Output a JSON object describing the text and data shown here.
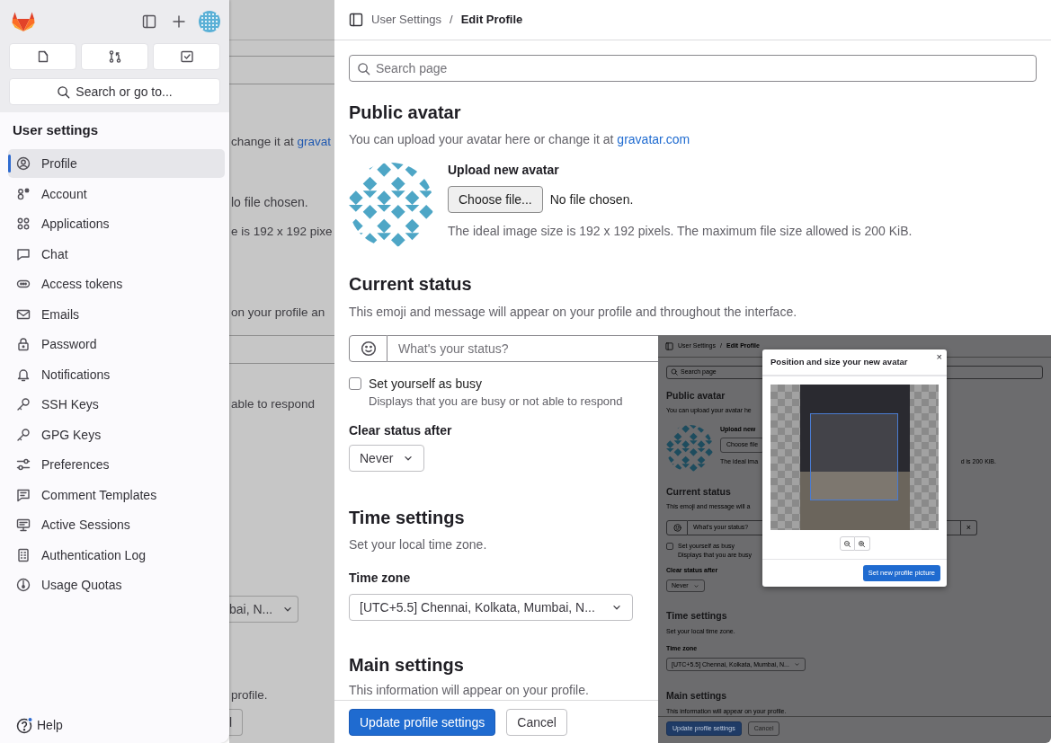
{
  "sidebar": {
    "search_button": "Search or go to...",
    "heading": "User settings",
    "items": [
      {
        "label": "Profile",
        "selected": true
      },
      {
        "label": "Account",
        "selected": false
      },
      {
        "label": "Applications",
        "selected": false
      },
      {
        "label": "Chat",
        "selected": false
      },
      {
        "label": "Access tokens",
        "selected": false
      },
      {
        "label": "Emails",
        "selected": false
      },
      {
        "label": "Password",
        "selected": false
      },
      {
        "label": "Notifications",
        "selected": false
      },
      {
        "label": "SSH Keys",
        "selected": false
      },
      {
        "label": "GPG Keys",
        "selected": false
      },
      {
        "label": "Preferences",
        "selected": false
      },
      {
        "label": "Comment Templates",
        "selected": false
      },
      {
        "label": "Active Sessions",
        "selected": false
      },
      {
        "label": "Authentication Log",
        "selected": false
      },
      {
        "label": "Usage Quotas",
        "selected": false
      }
    ],
    "help": "Help"
  },
  "background_page": {
    "description": "change it at ",
    "link": "gravat",
    "no_file": "lo file chosen.",
    "hint": "e is 192 x 192 pixe",
    "status_description": "on your profile an",
    "busy_help": "able to respond",
    "time_zone": "bai, N...",
    "main_description": "profile.",
    "cancel_button": "l"
  },
  "breadcrumb": {
    "items": [
      "User Settings",
      "Edit Profile"
    ],
    "separator": "/"
  },
  "search": {
    "placeholder": "Search page"
  },
  "public_avatar": {
    "title": "Public avatar",
    "description": "You can upload your avatar here or change it at ",
    "link": "gravatar.com",
    "upload_label": "Upload new avatar",
    "choose_button": "Choose file...",
    "no_file": "No file chosen.",
    "hint": "The ideal image size is 192 x 192 pixels. The maximum file size allowed is 200 KiB."
  },
  "current_status": {
    "title": "Current status",
    "description": "This emoji and message will appear on your profile and throughout the interface.",
    "status_placeholder": "What's your status?",
    "busy": {
      "label": "Set yourself as busy",
      "help": "Displays that you are busy or not able to respond",
      "checked": false
    },
    "clear_label": "Clear status after",
    "clear_value": "Never"
  },
  "time_settings": {
    "title": "Time settings",
    "description": "Set your local time zone.",
    "zone_label": "Time zone",
    "zone_value": "[UTC+5.5] Chennai, Kolkata, Mumbai, N..."
  },
  "main_settings": {
    "title": "Main settings",
    "description": "This information will appear on your profile."
  },
  "footer": {
    "buttons": [
      {
        "label": "Update profile settings",
        "kind": "primary"
      },
      {
        "label": "Cancel",
        "kind": "secondary"
      }
    ]
  },
  "inset": {
    "breadcrumb": {
      "items": [
        "User Settings",
        "Edit Profile"
      ],
      "separator": "/"
    },
    "search_placeholder": "Search page",
    "public_avatar": {
      "title": "Public avatar",
      "description": "You can upload your avatar he",
      "upload_label": "Upload new",
      "choose_button": "Choose file",
      "hint_start": "The ideal ima",
      "hint_end": "d is 200 KiB."
    },
    "current_status": {
      "title": "Current status",
      "description": "This emoji and message will a",
      "status_placeholder": "What's your status?",
      "clear_button": "×",
      "busy": {
        "label": "Set yourself as busy",
        "help": "Displays that you are busy",
        "checked": false
      },
      "clear_label": "Clear status after",
      "clear_value": "Never"
    },
    "time_settings": {
      "title": "Time settings",
      "description": "Set your local time zone.",
      "zone_label": "Time zone",
      "zone_value": "[UTC+5.5] Chennai, Kolkata, Mumbai, N..."
    },
    "main_settings": {
      "title": "Main settings",
      "description": "This information will appear on your profile."
    },
    "footer": {
      "buttons": [
        {
          "label": "Update profile settings",
          "kind": "primary"
        },
        {
          "label": "Cancel",
          "kind": "secondary"
        }
      ]
    },
    "modal": {
      "title": "Position and size your new avatar",
      "close": "×",
      "action": "Set new profile picture"
    }
  }
}
